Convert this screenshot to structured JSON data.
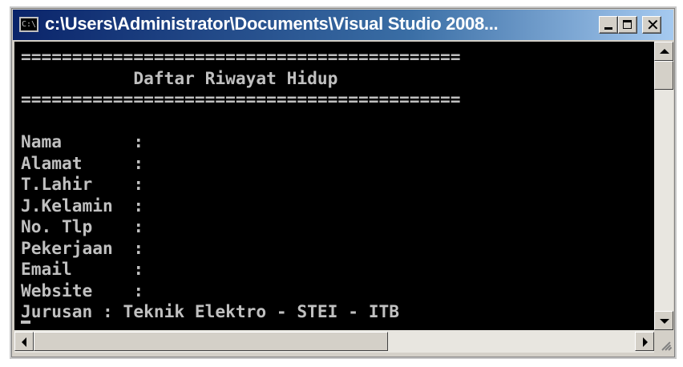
{
  "window": {
    "title": "c:\\Users\\Administrator\\Documents\\Visual Studio 2008...",
    "icon_label": "C:\\",
    "icons": {
      "app": "console-app-icon",
      "minimize": "minimize-icon",
      "maximize": "maximize-icon",
      "close": "close-icon"
    },
    "close_glyph": "✕"
  },
  "console": {
    "lines": [
      "===========================================",
      "           Daftar Riwayat Hidup",
      "===========================================",
      "",
      "Nama       :",
      "Alamat     :",
      "T.Lahir    :",
      "J.Kelamin  :",
      "No. Tlp    :",
      "Pekerjaan  :",
      "Email      :",
      "Website    :",
      "Jurusan : Teknik Elektro - STEI - ITB"
    ]
  },
  "scrollbars": {
    "vertical": {
      "up_icon": "scroll-up-arrow-icon",
      "down_icon": "scroll-down-arrow-icon",
      "position": 0
    },
    "horizontal": {
      "left_icon": "scroll-left-arrow-icon",
      "right_icon": "scroll-right-arrow-icon",
      "position": 0
    }
  }
}
